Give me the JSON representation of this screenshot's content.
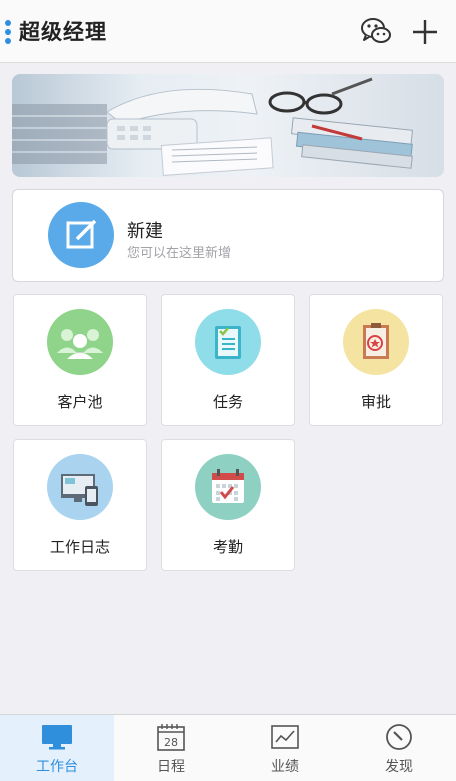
{
  "header": {
    "title": "超级经理",
    "icons": [
      "menu-icon",
      "wechat-icon",
      "plus-icon"
    ]
  },
  "new_card": {
    "title": "新建",
    "subtitle": "您可以在这里新增",
    "icon": "edit-icon"
  },
  "tiles": [
    {
      "label": "客户池",
      "icon": "people-icon",
      "color": "#8fd48a"
    },
    {
      "label": "任务",
      "icon": "checklist-icon",
      "color": "#8fdde8"
    },
    {
      "label": "审批",
      "icon": "stamp-document-icon",
      "color": "#f5e3a2"
    },
    {
      "label": "工作日志",
      "icon": "devices-icon",
      "color": "#a9d3ef"
    },
    {
      "label": "考勤",
      "icon": "calendar-check-icon",
      "color": "#8ed1c2"
    }
  ],
  "tabbar": {
    "active_index": 0,
    "tabs": [
      {
        "label": "工作台",
        "icon": "monitor-icon"
      },
      {
        "label": "日程",
        "icon": "calendar-icon",
        "badge": "28"
      },
      {
        "label": "业绩",
        "icon": "chart-icon"
      },
      {
        "label": "发现",
        "icon": "compass-icon"
      }
    ]
  },
  "colors": {
    "accent": "#2f8fdc",
    "background": "#efeff4"
  }
}
